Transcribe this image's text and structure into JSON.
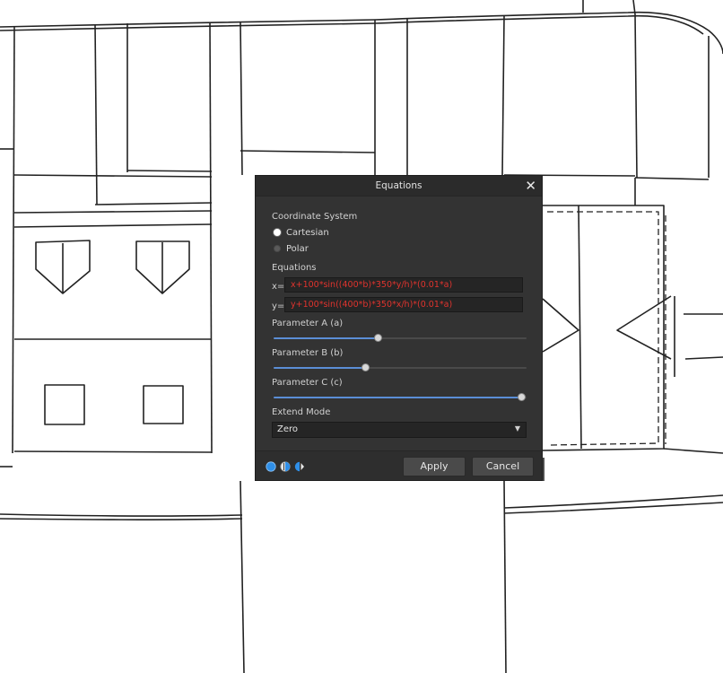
{
  "dialog": {
    "title": "Equations",
    "close_glyph": "✕",
    "coordinate_system": {
      "label": "Coordinate System",
      "options": [
        {
          "label": "Cartesian",
          "selected": true
        },
        {
          "label": "Polar",
          "selected": false
        }
      ]
    },
    "equations": {
      "label": "Equations",
      "x_prefix": "x=",
      "x_value": "x+100*sin((400*b)*350*y/h)*(0.01*a)",
      "y_prefix": "y=",
      "y_value": "y+100*sin((400*b)*350*x/h)*(0.01*a)"
    },
    "parameters": [
      {
        "label": "Parameter A (a)",
        "fraction": 0.41
      },
      {
        "label": "Parameter B (b)",
        "fraction": 0.36
      },
      {
        "label": "Parameter C (c)",
        "fraction": 0.98
      }
    ],
    "extend_mode": {
      "label": "Extend Mode",
      "value": "Zero"
    },
    "buttons": {
      "apply": "Apply",
      "cancel": "Cancel"
    },
    "mode_icons": [
      "blend-mode-icon",
      "half-mode-icon",
      "mirror-mode-icon"
    ],
    "accent_color": "#5b8ed6",
    "equation_text_color": "#e0342e"
  }
}
